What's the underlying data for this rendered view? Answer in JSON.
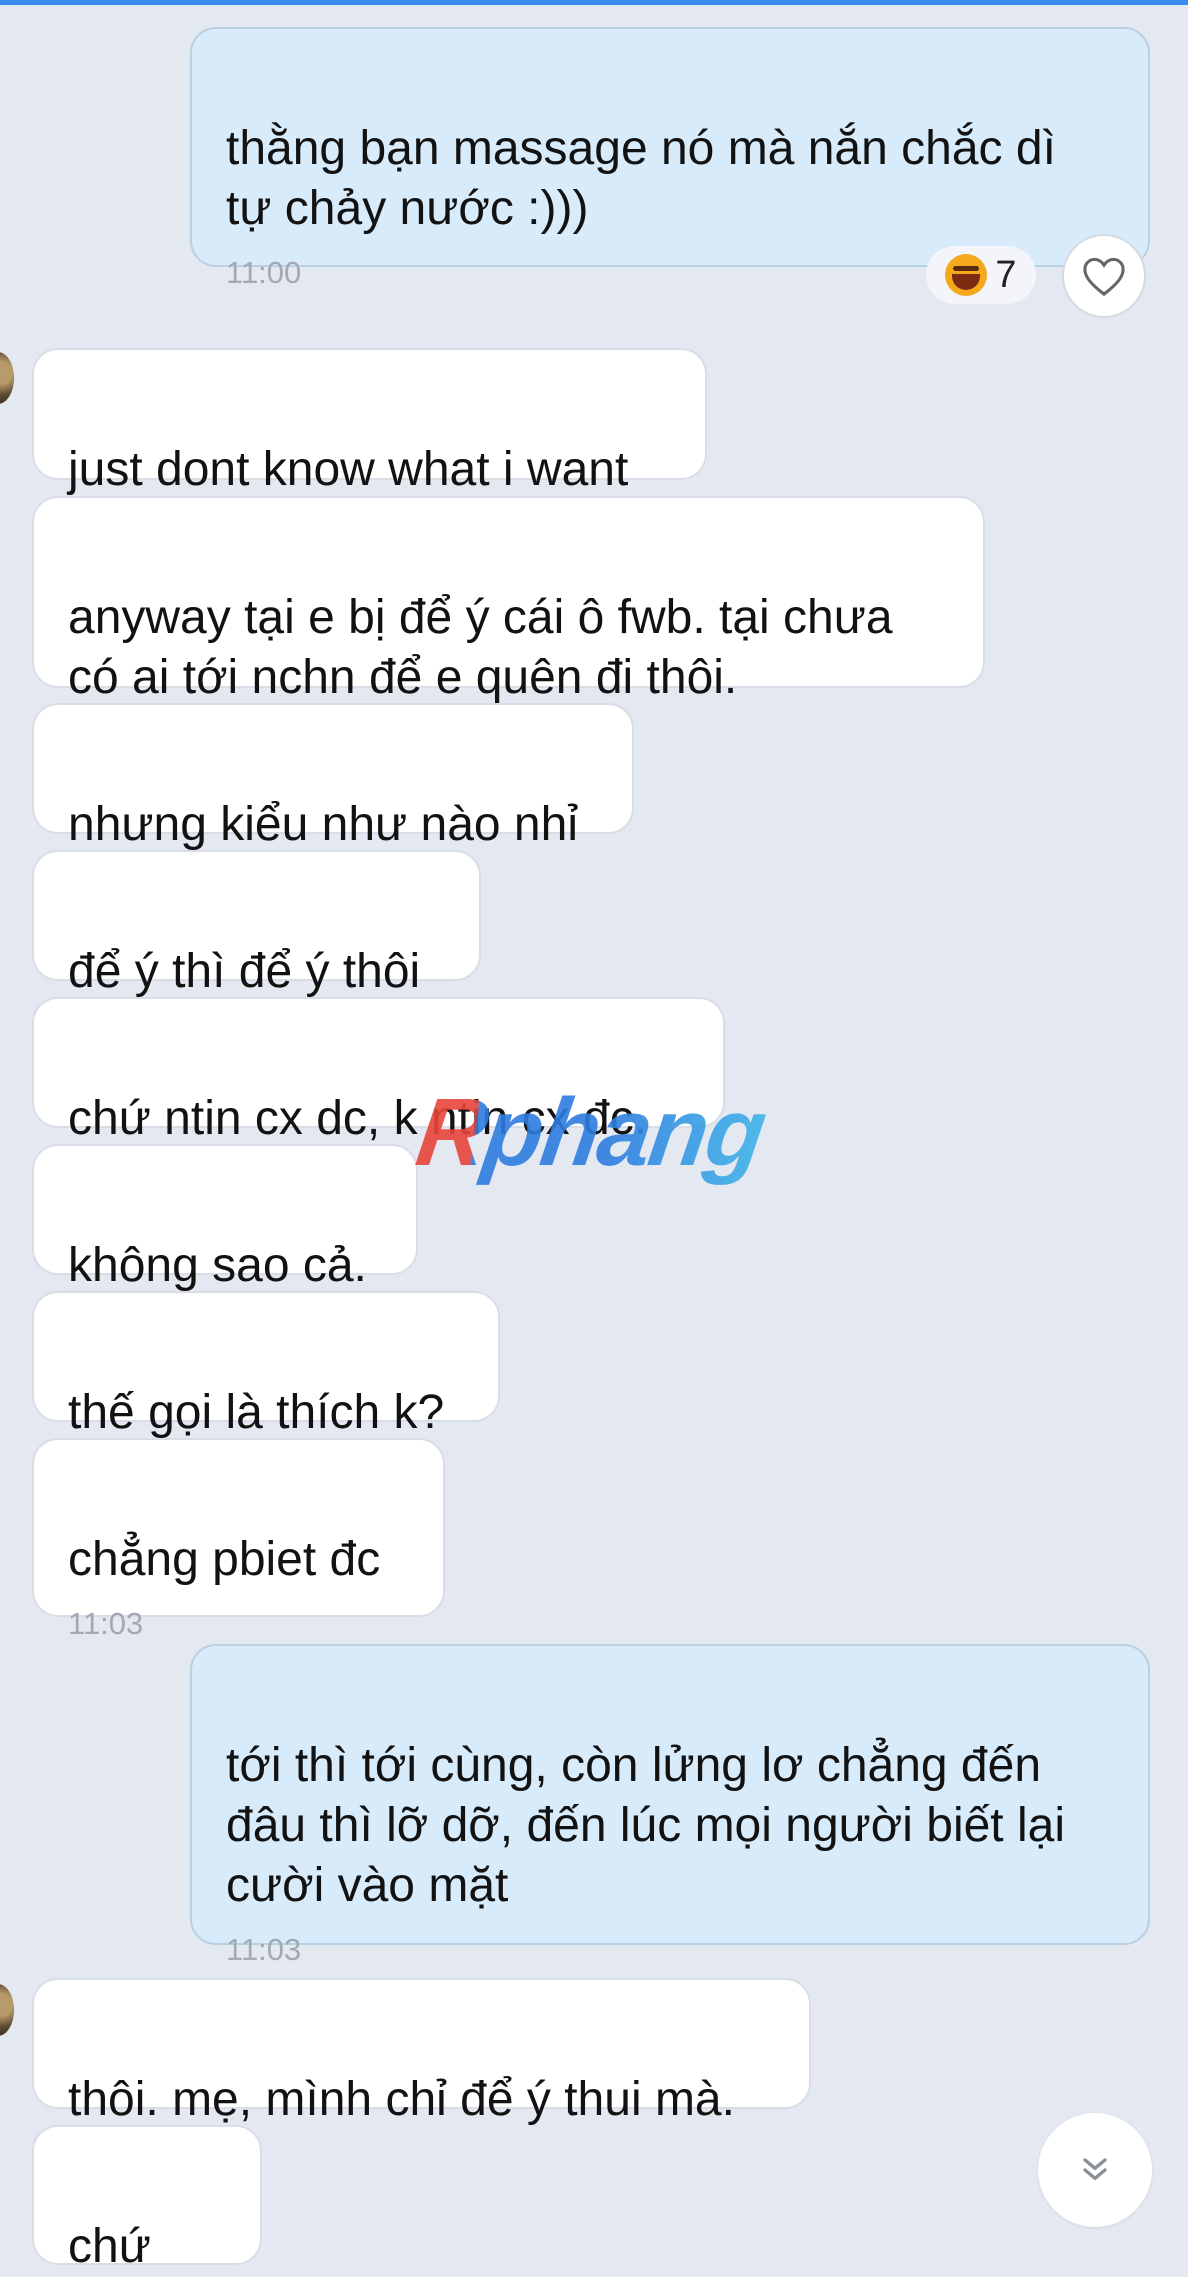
{
  "messages": [
    {
      "text": "thằng bạn massage nó mà nắn chắc dì\ntự chảy nước :)))",
      "time": "11:00"
    },
    {
      "text": "just dont know what i want"
    },
    {
      "text": "anyway tại e bị để ý cái ô fwb. tại chưa\ncó ai tới nchn để e quên đi thôi."
    },
    {
      "text": "nhưng kiểu như nào nhỉ"
    },
    {
      "text": "để ý thì để ý thôi"
    },
    {
      "text": "chứ ntin cx dc, k ntin cx đc."
    },
    {
      "text": "không sao cả."
    },
    {
      "text": "thế gọi là thích k?"
    },
    {
      "text": "chẳng pbiet đc",
      "time": "11:03"
    },
    {
      "text": "tới thì tới cùng, còn lửng lơ chẳng đến\nđâu thì lỡ dỡ, đến lúc mọi người biết lại\ncười vào mặt",
      "time": "11:03"
    },
    {
      "text": "thôi. mẹ, mình chỉ để ý thui mà."
    },
    {
      "text": "chứ"
    }
  ],
  "reaction": {
    "emoji": "laughing-emoji",
    "count": "7"
  },
  "icons": {
    "heart": "heart-icon",
    "scroll_down": "double-chevron-down-icon"
  },
  "watermark": "Rphang",
  "colors": {
    "accent": "#3b8cf0",
    "outgoing_bubble": "#d7ebfb",
    "incoming_bubble": "#ffffff",
    "background": "#e4e8f1"
  }
}
